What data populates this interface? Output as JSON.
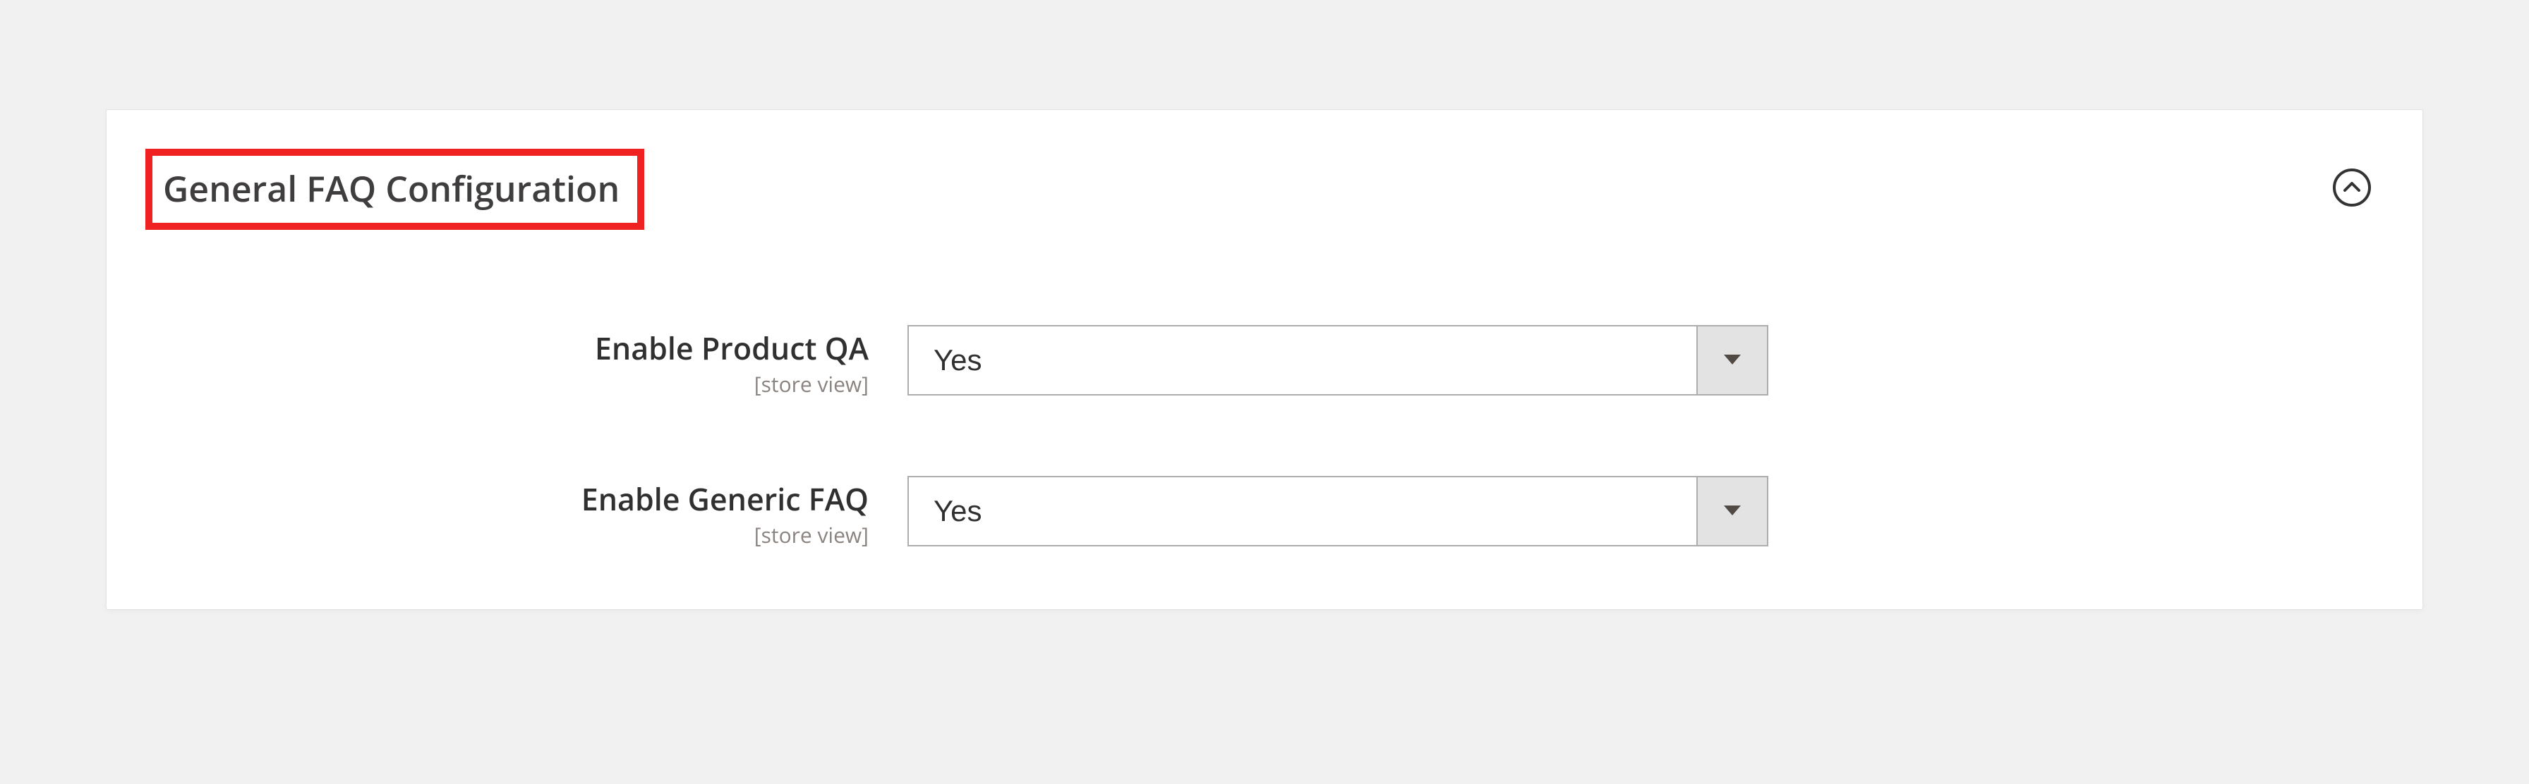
{
  "section": {
    "title": "General FAQ Configuration"
  },
  "fields": [
    {
      "label": "Enable Product QA",
      "scope": "[store view]",
      "value": "Yes"
    },
    {
      "label": "Enable Generic FAQ",
      "scope": "[store view]",
      "value": "Yes"
    }
  ]
}
